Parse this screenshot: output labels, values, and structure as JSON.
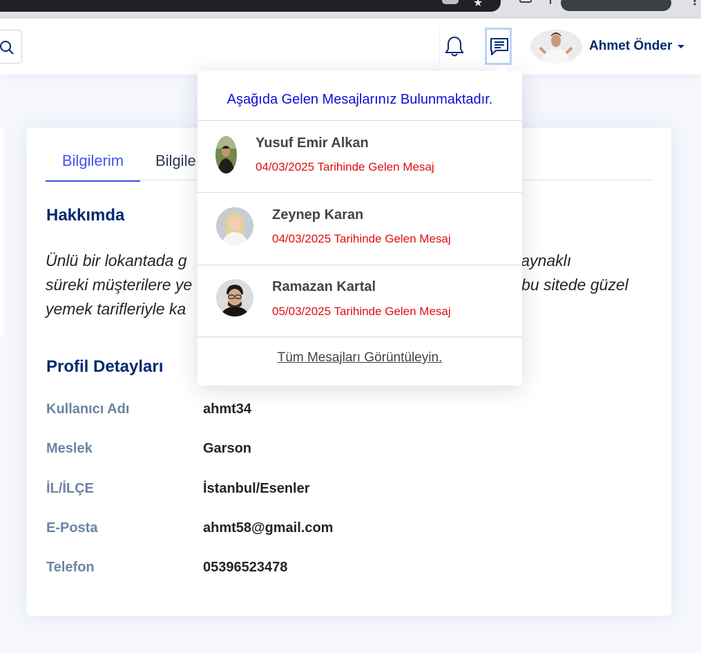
{
  "header": {
    "user_name": "Ahmet Önder"
  },
  "tabs": [
    {
      "label": "Bilgilerim"
    },
    {
      "label": "Bilgile"
    }
  ],
  "about": {
    "title": "Hakkımda",
    "line1": "Ünlü bir lokantada g",
    "line1_end": "den kaynaklı",
    "line2": "süreki müşterilere ye",
    "line2_end": "bu sitede güzel",
    "line3": "yemek tarifleriyle ka"
  },
  "details": {
    "title": "Profil Detayları",
    "rows": [
      {
        "label": "Kullanıcı Adı",
        "value": "ahmt34"
      },
      {
        "label": "Meslek",
        "value": "Garson"
      },
      {
        "label": "İL/İLÇE",
        "value": "İstanbul/Esenler"
      },
      {
        "label": "E-Posta",
        "value": "ahmt58@gmail.com"
      },
      {
        "label": "Telefon",
        "value": "05396523478"
      }
    ]
  },
  "messages": {
    "header": "Aşağıda Gelen Mesajlarınız Bulunmaktadır.",
    "items": [
      {
        "name": "Yusuf Emir Alkan",
        "date": "04/03/2025 Tarihinde Gelen Mesaj"
      },
      {
        "name": "Zeynep Karan",
        "date": "04/03/2025 Tarihinde Gelen Mesaj"
      },
      {
        "name": "Ramazan Kartal",
        "date": "05/03/2025 Tarihinde Gelen Mesaj"
      }
    ],
    "footer": "Tüm Mesajları Görüntüleyin."
  },
  "colors": {
    "primary": "#012970",
    "accent": "#4154f1",
    "date_red": "#e00d0d",
    "dropdown_header_blue": "#0d0dd6"
  }
}
